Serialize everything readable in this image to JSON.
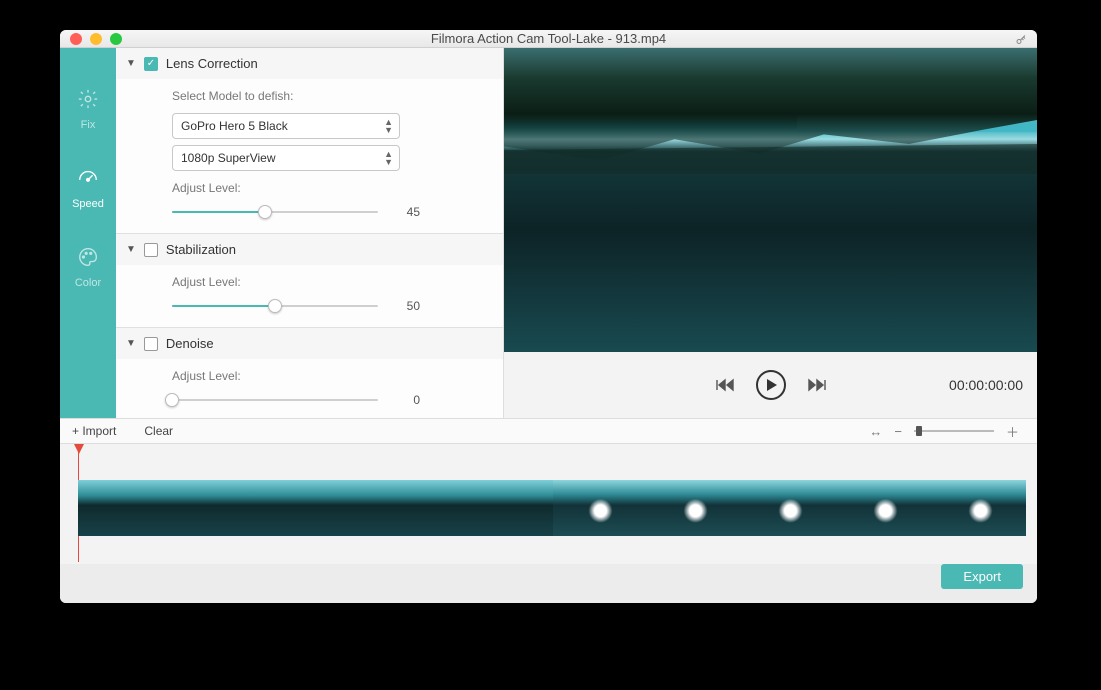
{
  "window": {
    "title": "Filmora Action Cam Tool-Lake - 913.mp4"
  },
  "sidebar": {
    "items": [
      {
        "label": "Fix",
        "icon": "gear-icon"
      },
      {
        "label": "Speed",
        "icon": "gauge-icon"
      },
      {
        "label": "Color",
        "icon": "palette-icon"
      }
    ]
  },
  "panel": {
    "lens": {
      "title": "Lens Correction",
      "checked": true,
      "prompt": "Select Model to defish:",
      "model": "GoPro Hero 5 Black",
      "resolution": "1080p SuperView",
      "adjust_label": "Adjust Level:",
      "level": 45
    },
    "stab": {
      "title": "Stabilization",
      "checked": false,
      "adjust_label": "Adjust Level:",
      "level": 50
    },
    "denoise": {
      "title": "Denoise",
      "checked": false,
      "adjust_label": "Adjust Level:",
      "level": 0
    }
  },
  "preview": {
    "timecode": "00:00:00:00"
  },
  "toolbar": {
    "import": "+ Import",
    "clear": "Clear"
  },
  "footer": {
    "export": "Export"
  }
}
